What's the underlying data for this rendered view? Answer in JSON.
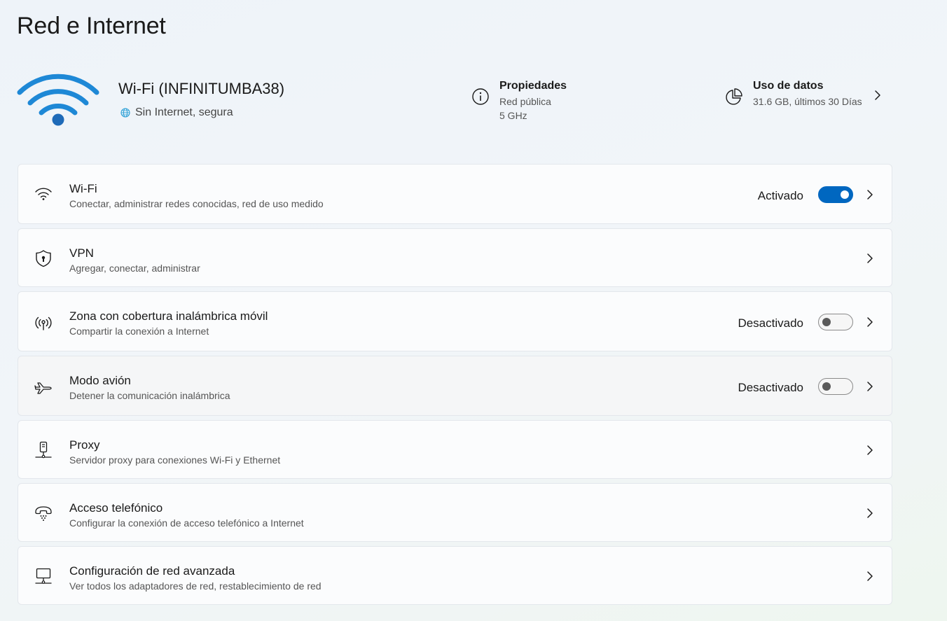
{
  "page": {
    "title": "Red e Internet"
  },
  "connection": {
    "name": "Wi-Fi (INFINITUMBA38)",
    "status": "Sin Internet, segura",
    "accent_color": "#1e88d6",
    "icon": "wifi-large-icon"
  },
  "properties": {
    "title": "Propiedades",
    "network_type": "Red pública",
    "band": "5 GHz",
    "icon": "info-icon"
  },
  "data_usage": {
    "title": "Uso de datos",
    "summary": "31.6 GB, últimos 30 Días",
    "icon": "pie-chart-icon"
  },
  "settings": [
    {
      "id": "wifi",
      "title": "Wi-Fi",
      "subtitle": "Conectar, administrar redes conocidas, red de uso medido",
      "state": "Activado",
      "toggle": true,
      "icon": "wifi-icon"
    },
    {
      "id": "vpn",
      "title": "VPN",
      "subtitle": "Agregar, conectar, administrar",
      "icon": "shield-icon"
    },
    {
      "id": "hotspot",
      "title": "Zona con cobertura inalámbrica móvil",
      "subtitle": "Compartir la conexión a Internet",
      "state": "Desactivado",
      "toggle": false,
      "icon": "hotspot-icon"
    },
    {
      "id": "airplane",
      "title": "Modo avión",
      "subtitle": "Detener la comunicación inalámbrica",
      "state": "Desactivado",
      "toggle": false,
      "icon": "airplane-icon"
    },
    {
      "id": "proxy",
      "title": "Proxy",
      "subtitle": "Servidor proxy para conexiones Wi-Fi y Ethernet",
      "icon": "proxy-icon"
    },
    {
      "id": "dialup",
      "title": "Acceso telefónico",
      "subtitle": "Configurar la conexión de acceso telefónico a Internet",
      "icon": "phone-icon"
    },
    {
      "id": "advanced",
      "title": "Configuración de red avanzada",
      "subtitle": "Ver todos los adaptadores de red, restablecimiento de red",
      "icon": "network-pc-icon"
    }
  ],
  "colors": {
    "toggle_on": "#0067c0",
    "accent": "#1e88d6"
  }
}
